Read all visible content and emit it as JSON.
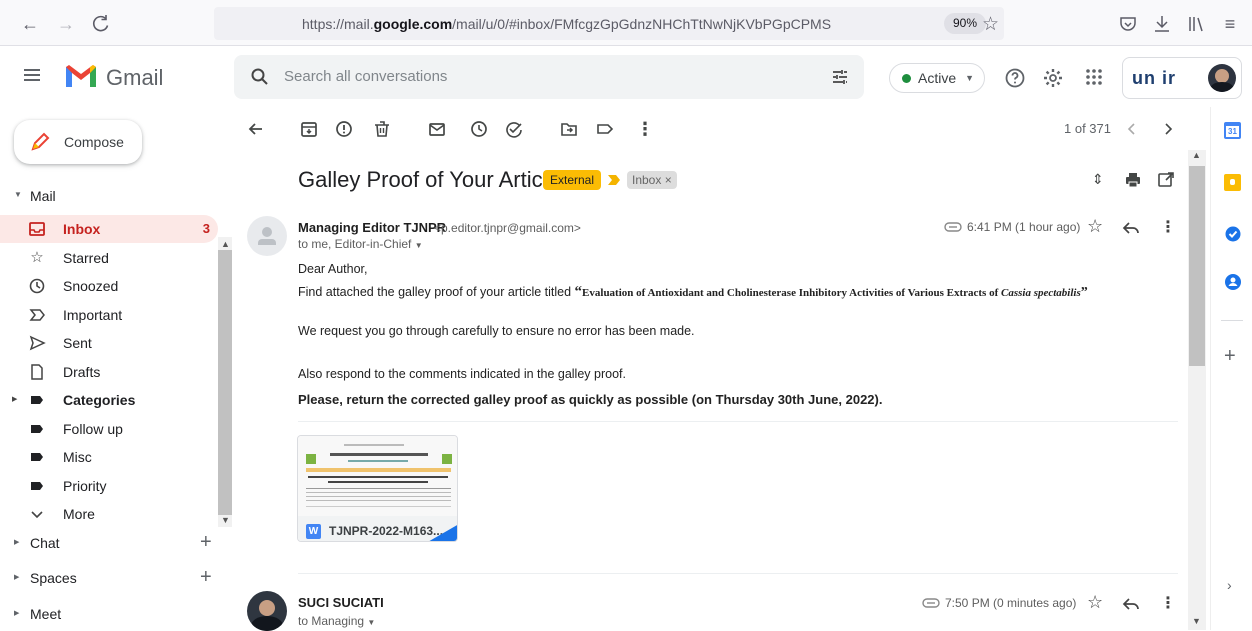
{
  "browser": {
    "url_prefix": "https://mail.",
    "url_domain": "google.com",
    "url_path": "/mail/u/0/#inbox/FMfcgzGpGdnzNHChTtNwNjKVbPGpCPMS",
    "zoom": "90%"
  },
  "gmail": {
    "brand": "Gmail",
    "search_placeholder": "Search all conversations",
    "status": "Active",
    "org_logo_text": "un ir"
  },
  "sidebar": {
    "compose": "Compose",
    "mail_section": "Mail",
    "items": [
      {
        "label": "Inbox",
        "icon": "inbox-icon",
        "count": "3"
      },
      {
        "label": "Starred",
        "icon": "star-icon"
      },
      {
        "label": "Snoozed",
        "icon": "clock-icon"
      },
      {
        "label": "Important",
        "icon": "important-icon"
      },
      {
        "label": "Sent",
        "icon": "send-icon"
      },
      {
        "label": "Drafts",
        "icon": "draft-icon"
      },
      {
        "label": "Categories",
        "icon": "label-icon"
      },
      {
        "label": "Follow up",
        "icon": "label-icon"
      },
      {
        "label": "Misc",
        "icon": "label-icon"
      },
      {
        "label": "Priority",
        "icon": "label-icon"
      },
      {
        "label": "More",
        "icon": "chevron-down-icon"
      }
    ],
    "chat": "Chat",
    "spaces": "Spaces",
    "meet": "Meet"
  },
  "toolbar": {
    "pager": "1 of 371"
  },
  "thread": {
    "subject": "Galley Proof of Your Article",
    "label_external": "External",
    "label_inbox": "Inbox",
    "label_inbox_close": "×",
    "message1": {
      "sender_name": "Managing Editor TJNPR",
      "sender_email": "<p.editor.tjnpr@gmail.com>",
      "recipients": "to me, Editor-in-Chief",
      "time": "6:41 PM (1 hour ago)",
      "greeting": "Dear Author,",
      "line1_prefix": "Find attached the galley proof of your article titled ",
      "line1_title_open": "“",
      "line1_title": "Evaluation of Antioxidant and Cholinesterase Inhibitory Activities of Various Extracts of ",
      "line1_title_species": "Cassia spectabilis",
      "line1_title_close": "”",
      "line2": "We request you go through carefully to ensure no error has been made.",
      "line3": "Also respond to the comments indicated in the galley proof.",
      "line4": "Please, return the corrected galley proof as quickly as possible (on Thursday 30th June, 2022).",
      "attachment_name": "TJNPR-2022-M163..."
    },
    "message2": {
      "sender_name": "SUCI SUCIATI",
      "recipients": "to Managing",
      "time": "7:50 PM (0 minutes ago)"
    }
  },
  "colors": {
    "gmail_red": "#c5221f",
    "external_label": "#fbbc04",
    "active_green": "#1e8e3e"
  }
}
